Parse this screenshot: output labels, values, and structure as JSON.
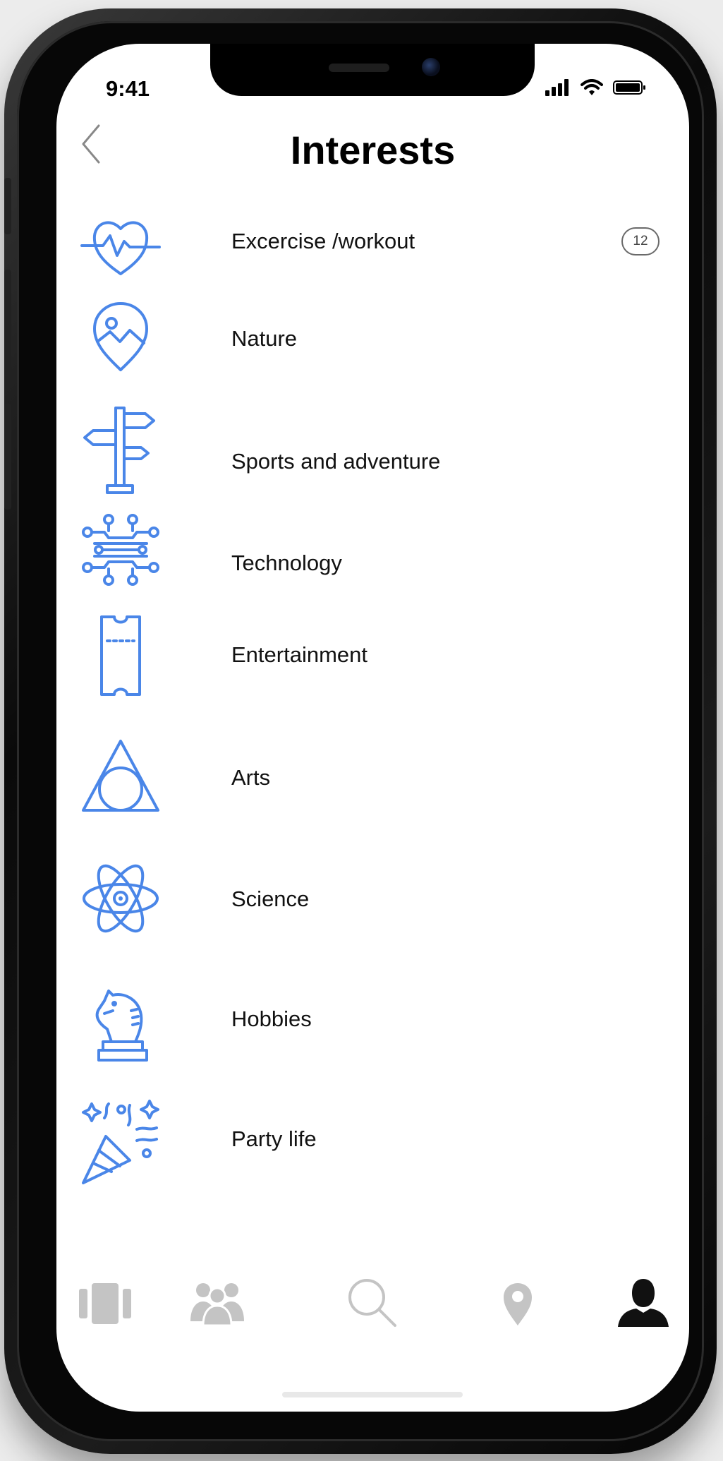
{
  "status_bar": {
    "time": "9:41"
  },
  "header": {
    "title": "Interests"
  },
  "interests": [
    {
      "label": "Excercise /workout",
      "icon": "heart-pulse-icon",
      "count": "12"
    },
    {
      "label": "Nature",
      "icon": "map-pin-mountain-icon"
    },
    {
      "label": "Sports and adventure",
      "icon": "signpost-icon"
    },
    {
      "label": "Technology",
      "icon": "circuit-icon"
    },
    {
      "label": "Entertainment",
      "icon": "ticket-icon"
    },
    {
      "label": "Arts",
      "icon": "triangle-circle-icon"
    },
    {
      "label": "Science",
      "icon": "atom-icon"
    },
    {
      "label": "Hobbies",
      "icon": "chess-knight-icon"
    },
    {
      "label": "Party life",
      "icon": "party-popper-icon"
    }
  ],
  "tab_bar": {
    "tabs": [
      {
        "icon": "cards-icon",
        "active": false
      },
      {
        "icon": "people-icon",
        "active": false
      },
      {
        "icon": "search-icon",
        "active": false
      },
      {
        "icon": "location-pin-icon",
        "active": false
      },
      {
        "icon": "profile-icon",
        "active": true
      }
    ]
  },
  "colors": {
    "accent": "#4a86e8",
    "inactive_tab": "#c4c4c4",
    "active_tab": "#111111"
  }
}
